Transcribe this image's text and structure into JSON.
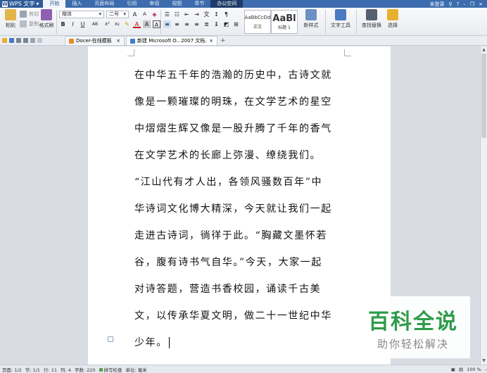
{
  "app": {
    "name": "WPS 文字"
  },
  "menu": {
    "tabs": [
      "开始",
      "插入",
      "页面布局",
      "引用",
      "审阅",
      "视图",
      "章节"
    ],
    "cloud_tab": "办公空间",
    "login": "未登录"
  },
  "ribbon": {
    "paste": "粘贴",
    "cut": "剪切",
    "copy": "复制",
    "format_painter": "格式刷",
    "font_name": "楷体",
    "font_size": "二号",
    "style_normal_preview": "AaBbCcDd",
    "style_normal": "正文",
    "style_heading_preview": "AaBl",
    "style_heading": "标题 1",
    "new_style": "新样式",
    "text_tools": "文字工具",
    "find_replace": "查找替换",
    "select": "选择"
  },
  "tabs": [
    {
      "label": "Docer-在线模板"
    },
    {
      "label": "新建 Microsoft O...2007 文档.docx *"
    }
  ],
  "document": {
    "lines": [
      "在中华五千年的浩瀚的历史中，古诗文就",
      "像是一颗璀璨的明珠，在文学艺术的星空",
      "中熠熠生辉又像是一股升腾了千年的香气",
      "在文学艺术的长廊上弥漫、缭绕我们。",
      "“江山代有才人出，各领风骚数百年”中",
      "华诗词文化博大精深，今天就让我们一起",
      "走进古诗词，徜徉于此。“胸藏文墨怀若",
      "谷，腹有诗书气自华。”今天，大家一起",
      "对诗答题，营造书香校园，诵读千古美",
      "文，以传承华夏文明，做二十一世纪中华",
      "少年。"
    ]
  },
  "status": {
    "page": "页面: 1/2",
    "section": "节: 1/1",
    "line": "行: 11",
    "col": "列: 4",
    "words": "字数: 220",
    "spell": "拼写检查",
    "unit": "单位: 毫米",
    "zoom": "100 %"
  },
  "watermark": {
    "title": "百科全说",
    "subtitle": "助你轻松解决"
  },
  "colors": {
    "accent": "#3c6cae",
    "watermark_green": "#2f9b4a"
  }
}
